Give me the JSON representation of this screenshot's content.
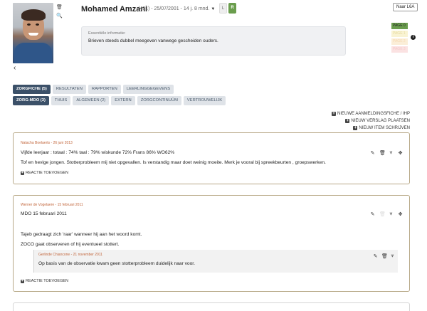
{
  "student": {
    "name": "Mohamed Amzani",
    "meta": "(431) - 25/07/2001 - 14 j. 8 mnd.",
    "badge_l": "L",
    "badge_r": "R"
  },
  "header": {
    "naar_button": "Naar L6A",
    "back_icon": "chevron-left-icon",
    "delete_icon": "trash-icon",
    "zoom_icon": "zoom-icon"
  },
  "info": {
    "label": "Essentiële informatie:",
    "text": "Brieven steeds dubbel meegeven vanwege gescheiden ouders."
  },
  "page_labels": [
    "PAGE 0",
    "PAGE 1",
    "PAGE 2",
    "PAGE 3"
  ],
  "page_label_colors": [
    "#6a9d4d",
    "#f9f3d3",
    "#fbeed8",
    "#fbe2e2"
  ],
  "tabs_row1": [
    {
      "label": "ZORGFICHE (5)",
      "active": true
    },
    {
      "label": "RESULTATEN",
      "active": false
    },
    {
      "label": "RAPPORTEN",
      "active": false
    },
    {
      "label": "LEERLINGGEGEVENS",
      "active": false
    }
  ],
  "tabs_row2": [
    {
      "label": "ZORG-MDO (3)",
      "active": true
    },
    {
      "label": "THUIS",
      "active": false
    },
    {
      "label": "ALGEMEEN (2)",
      "active": false
    },
    {
      "label": "EXTERN",
      "active": false
    },
    {
      "label": "ZORGCONTINUÜM",
      "active": false
    },
    {
      "label": "VERTROUWELIJK",
      "active": false
    }
  ],
  "actions": [
    "NIEUWE AANMELDINGSFICHE / IHP",
    "NIEUW VERSLAG PLAATSEN",
    "NIEUW ITEM SCHRIJVEN"
  ],
  "cards": [
    {
      "author": "Natacha Boelaerts - 26 juni 2013",
      "line1": "Vijfde leerjaar : totaal : 74%   taal : 79%   wiskunde 72%    Frans  86%     WO62%",
      "line2": "Tof en hevige jongen. Stotterprobleem mij niet opgevallen. Is verstandig maar doet weinig moeite. Merk je vooral bij spreekbeurten , groepswerken.",
      "reply": "REACTIE TOEVOEGEN"
    },
    {
      "author": "Werner de Vogelaere - 15 februari 2011",
      "line1": "MDO 15 februari 2011",
      "line2": "Tajeb gedraagt zich 'raar' wanneer hij aan het woord komt.",
      "line3": "ZOCO gaat observeren of hij eventueel stottert.",
      "sub_author": "Gerlinde Chiancone - 21 november 2011",
      "sub_text": "Op basis van de observatie kwam geen stotterprobleem duidelijk naar voor.",
      "reply": "REACTIE TOEVOEGEN"
    }
  ],
  "icons": {
    "edit": "edit-icon",
    "delete": "trash-icon",
    "share": "share-icon",
    "move": "move-icon",
    "info": "info-icon"
  }
}
